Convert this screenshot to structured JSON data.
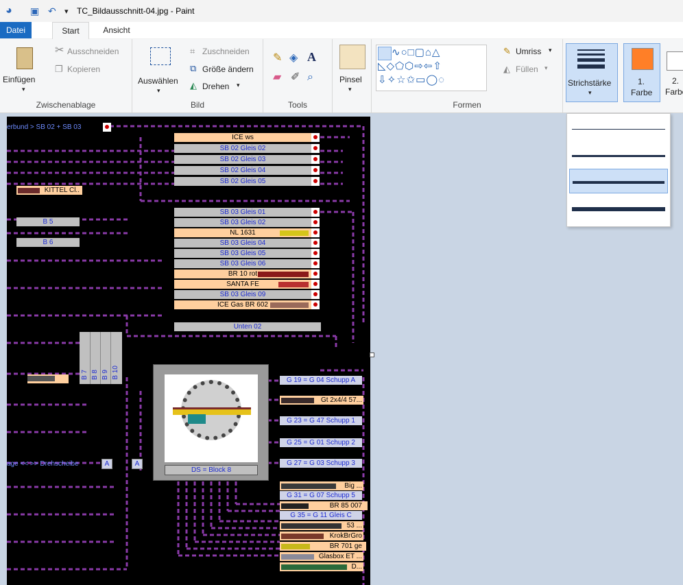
{
  "window": {
    "title": "TC_Bildausschnitt-04.jpg - Paint"
  },
  "tabs": [
    {
      "label": "Datei"
    },
    {
      "label": "Start"
    },
    {
      "label": "Ansicht"
    }
  ],
  "ribbon": {
    "clipboard": {
      "paste": "Einfügen",
      "cut": "Ausschneiden",
      "copy": "Kopieren",
      "label": "Zwischenablage"
    },
    "image": {
      "select": "Auswählen",
      "crop": "Zuschneiden",
      "resize": "Größe ändern",
      "rotate": "Drehen",
      "label": "Bild"
    },
    "tools": {
      "label": "Tools"
    },
    "brush": {
      "label": "Pinsel"
    },
    "shapes": {
      "outline": "Umriss",
      "fill": "Füllen",
      "label": "Formen"
    },
    "stroke": {
      "label": "Strichstärke"
    },
    "color1": {
      "label_a": "1.",
      "label_b": "Farbe",
      "value": "#ff7f27"
    },
    "color2": {
      "label_a": "2.",
      "label_b": "Farbe"
    }
  },
  "diagram": {
    "top_label": "erbund > SB 02 + SB 03",
    "upper_blocks": [
      "ICE ws",
      "SB 02   Gleis 02",
      "SB 02   Gleis 03",
      "SB 02   Gleis 04",
      "SB 02   Gleis 05"
    ],
    "middle_blocks": [
      "SB 03   Gleis 01",
      "SB 03   Gleis 02",
      "NL 1631",
      "SB 03   Gleis 04",
      "SB 03   Gleis 05",
      "SB 03   Gleis 06",
      "BR 10 rot",
      "SANTA FE",
      "SB 03   Gleis 09",
      "ICE Gas BR 602"
    ],
    "unten": "Unten 02",
    "left_blocks": [
      "KITTEL Cl..",
      "B 5",
      "B 6"
    ],
    "vertical_blocks": [
      "B 7",
      "B 8",
      "B 9",
      "B 10"
    ],
    "turntable_label": "DS  =  Block 8",
    "drehscheibe_label": "age << >> Drehscheibe",
    "a_label_1": "A",
    "a_label_2": "A",
    "right_blocks": [
      "G 19 = G 04  Schupp A",
      "Gt 2x4/4 57...",
      "G 23 = G 47  Schupp 1",
      "G 25 = G 01  Schupp 2",
      "G 27 = G 03  Schupp 3"
    ],
    "bottom_blocks": [
      "Big ...",
      "G 31 = G 07  Schupp 5",
      "BR 85 007",
      "G 35 = G 11  Gleis C",
      "53 ...",
      "KrokBrGro",
      "BR 701 ge",
      "Glasbox ET ...",
      "D..."
    ]
  }
}
